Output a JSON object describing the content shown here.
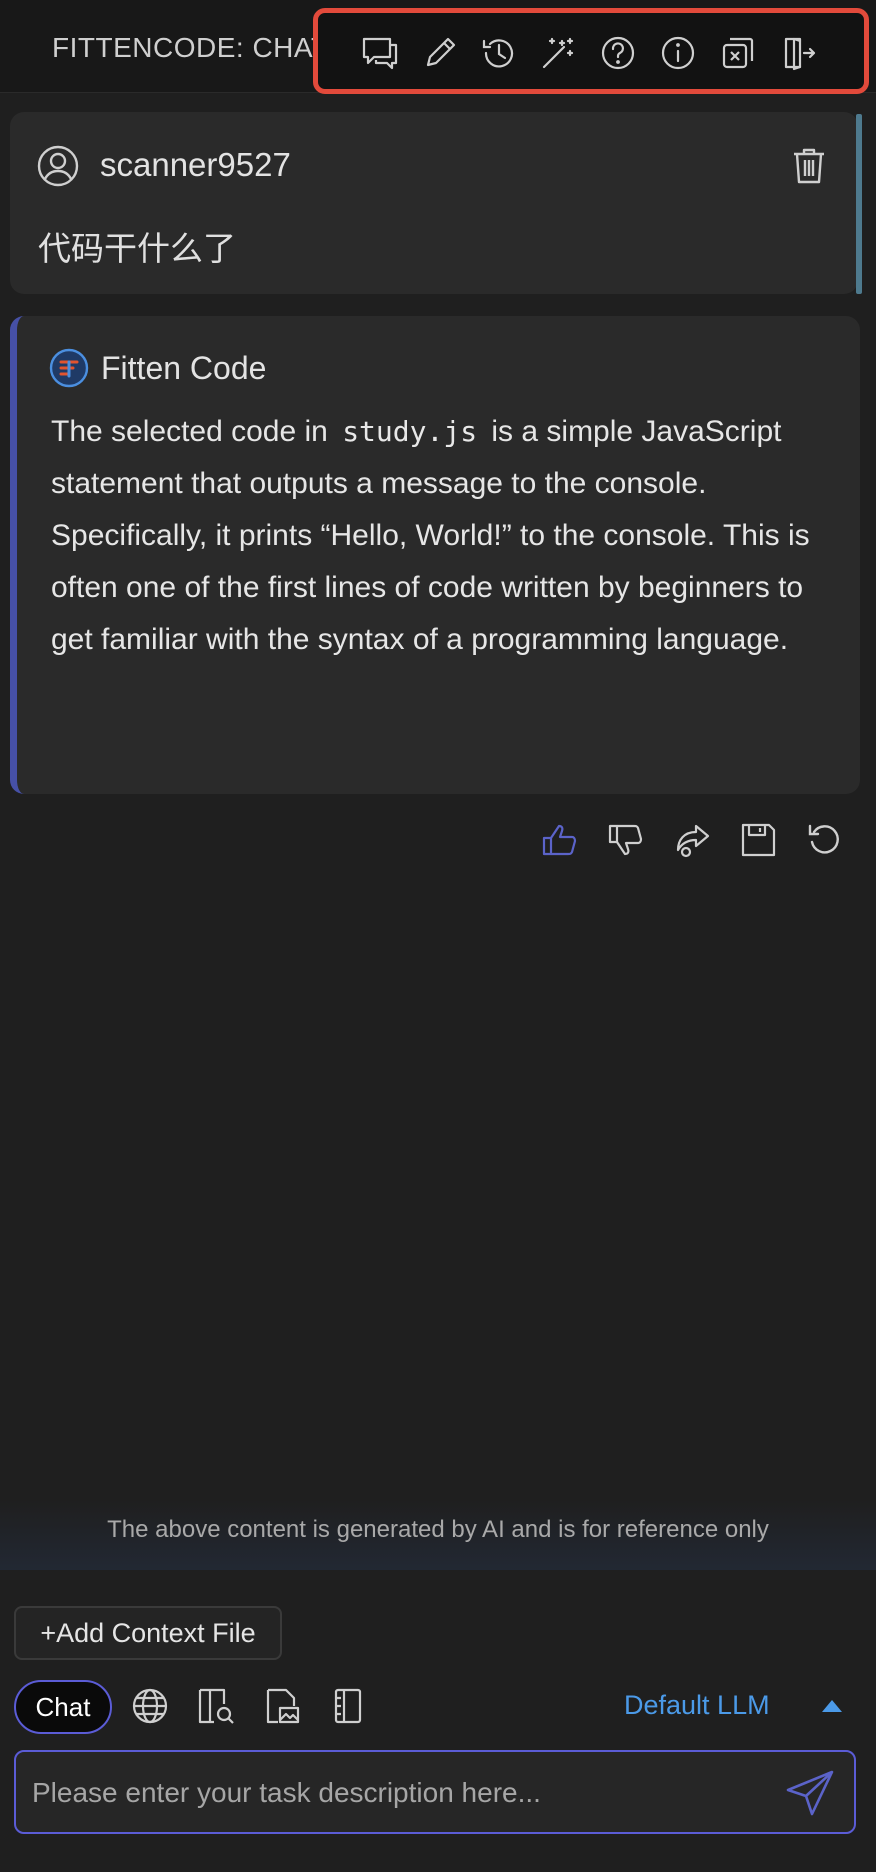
{
  "header": {
    "title": "FITTENCODE: CHAT",
    "toolbar": [
      {
        "icon": "new-chat-icon"
      },
      {
        "icon": "edit-icon"
      },
      {
        "icon": "history-icon"
      },
      {
        "icon": "magic-wand-icon"
      },
      {
        "icon": "help-icon"
      },
      {
        "icon": "info-icon"
      },
      {
        "icon": "close-window-icon"
      },
      {
        "icon": "logout-icon"
      }
    ]
  },
  "conversation": {
    "user": {
      "name": "scanner9527",
      "message": "代码干什么了"
    },
    "assistant": {
      "name": "Fitten Code",
      "text_before_code": "The selected code in ",
      "code": "study.js",
      "text_after_code": " is a simple JavaScript statement that outputs a message to the console. Specifically, it prints “Hello, World!” to the console. This is often one of the first lines of code written by beginners to get familiar with the syntax of a programming language."
    },
    "actions": [
      {
        "icon": "thumbs-up-icon"
      },
      {
        "icon": "thumbs-down-icon"
      },
      {
        "icon": "share-icon"
      },
      {
        "icon": "save-icon"
      },
      {
        "icon": "regenerate-icon"
      }
    ]
  },
  "footer": {
    "disclaimer": "The above content is generated by AI and is for reference only",
    "add_context_label": "+Add Context File",
    "mode_label": "Chat",
    "llm_label": "Default LLM",
    "input_placeholder": "Please enter your task description here..."
  },
  "colors": {
    "accent": "#5b5cd6",
    "highlight_border": "#e24a3b",
    "link_blue": "#4b9ae8"
  }
}
